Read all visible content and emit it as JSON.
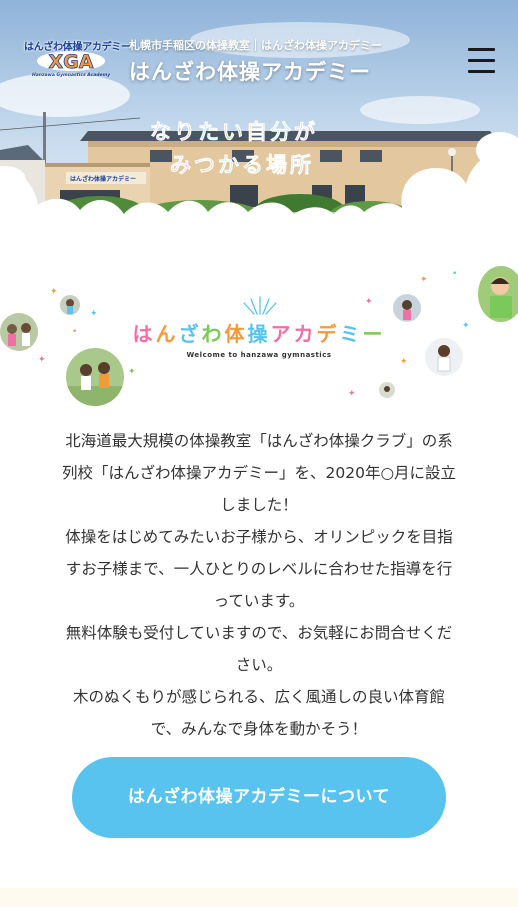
{
  "header": {
    "logo_small_text": "はんざわ体操アカデミー",
    "logo_mark": "XGA",
    "logo_tagline": "Hanzawa Gymnastics Academy",
    "subtitle": "札幌市手稲区の体操教室｜はんざわ体操アカデミー",
    "site_title": "はんざわ体操アカデミー",
    "menu_icon": "hamburger-menu-icon"
  },
  "hero": {
    "catch_line_1": "なりたい自分が",
    "catch_line_2": "みつかる場所",
    "sign_text": "はんざわ体操アカデミー"
  },
  "welcome": {
    "title": "はんざわ体操アカデミー",
    "subtitle": "Welcome to hanzawa gymnastics"
  },
  "intro": {
    "paragraphs": [
      "北海道最大規模の体操教室「はんざわ体操クラブ」の系列校「はんざわ体操アカデミー」を、2020年○月に設立しました！",
      "体操をはじめてみたいお子様から、オリンピックを目指すお子様まで、一人ひとりのレベルに合わせた指導を行っています。",
      "無料体験も受付していますので、お気軽にお問合せください。",
      "木のぬくもりが感じられる、広く風通しの良い体育館で、みんなで身体を動かそう！"
    ]
  },
  "cta": {
    "label": "はんざわ体操アカデミーについて"
  },
  "colors": {
    "accent": "#59c3f0",
    "navy": "#1b3f93",
    "orange": "#f39a3b",
    "pink": "#f06fa6",
    "green": "#7bc95a",
    "text": "#333333"
  }
}
